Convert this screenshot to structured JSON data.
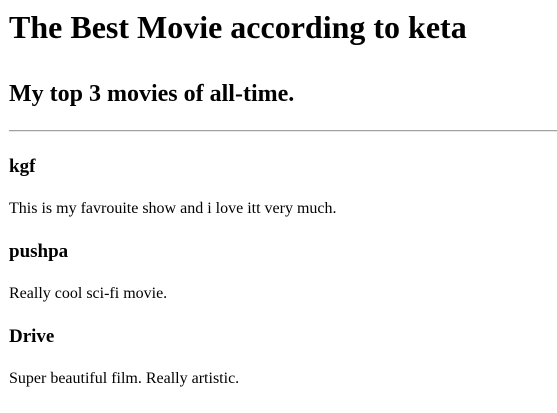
{
  "page": {
    "title": "The Best Movie according to keta",
    "subtitle": "My top 3 movies of all-time."
  },
  "movies": [
    {
      "name": "kgf",
      "description": "This is my favrouite show and i love itt very much."
    },
    {
      "name": "pushpa",
      "description": "Really cool sci-fi movie."
    },
    {
      "name": "Drive",
      "description": "Super beautiful film. Really artistic."
    }
  ]
}
